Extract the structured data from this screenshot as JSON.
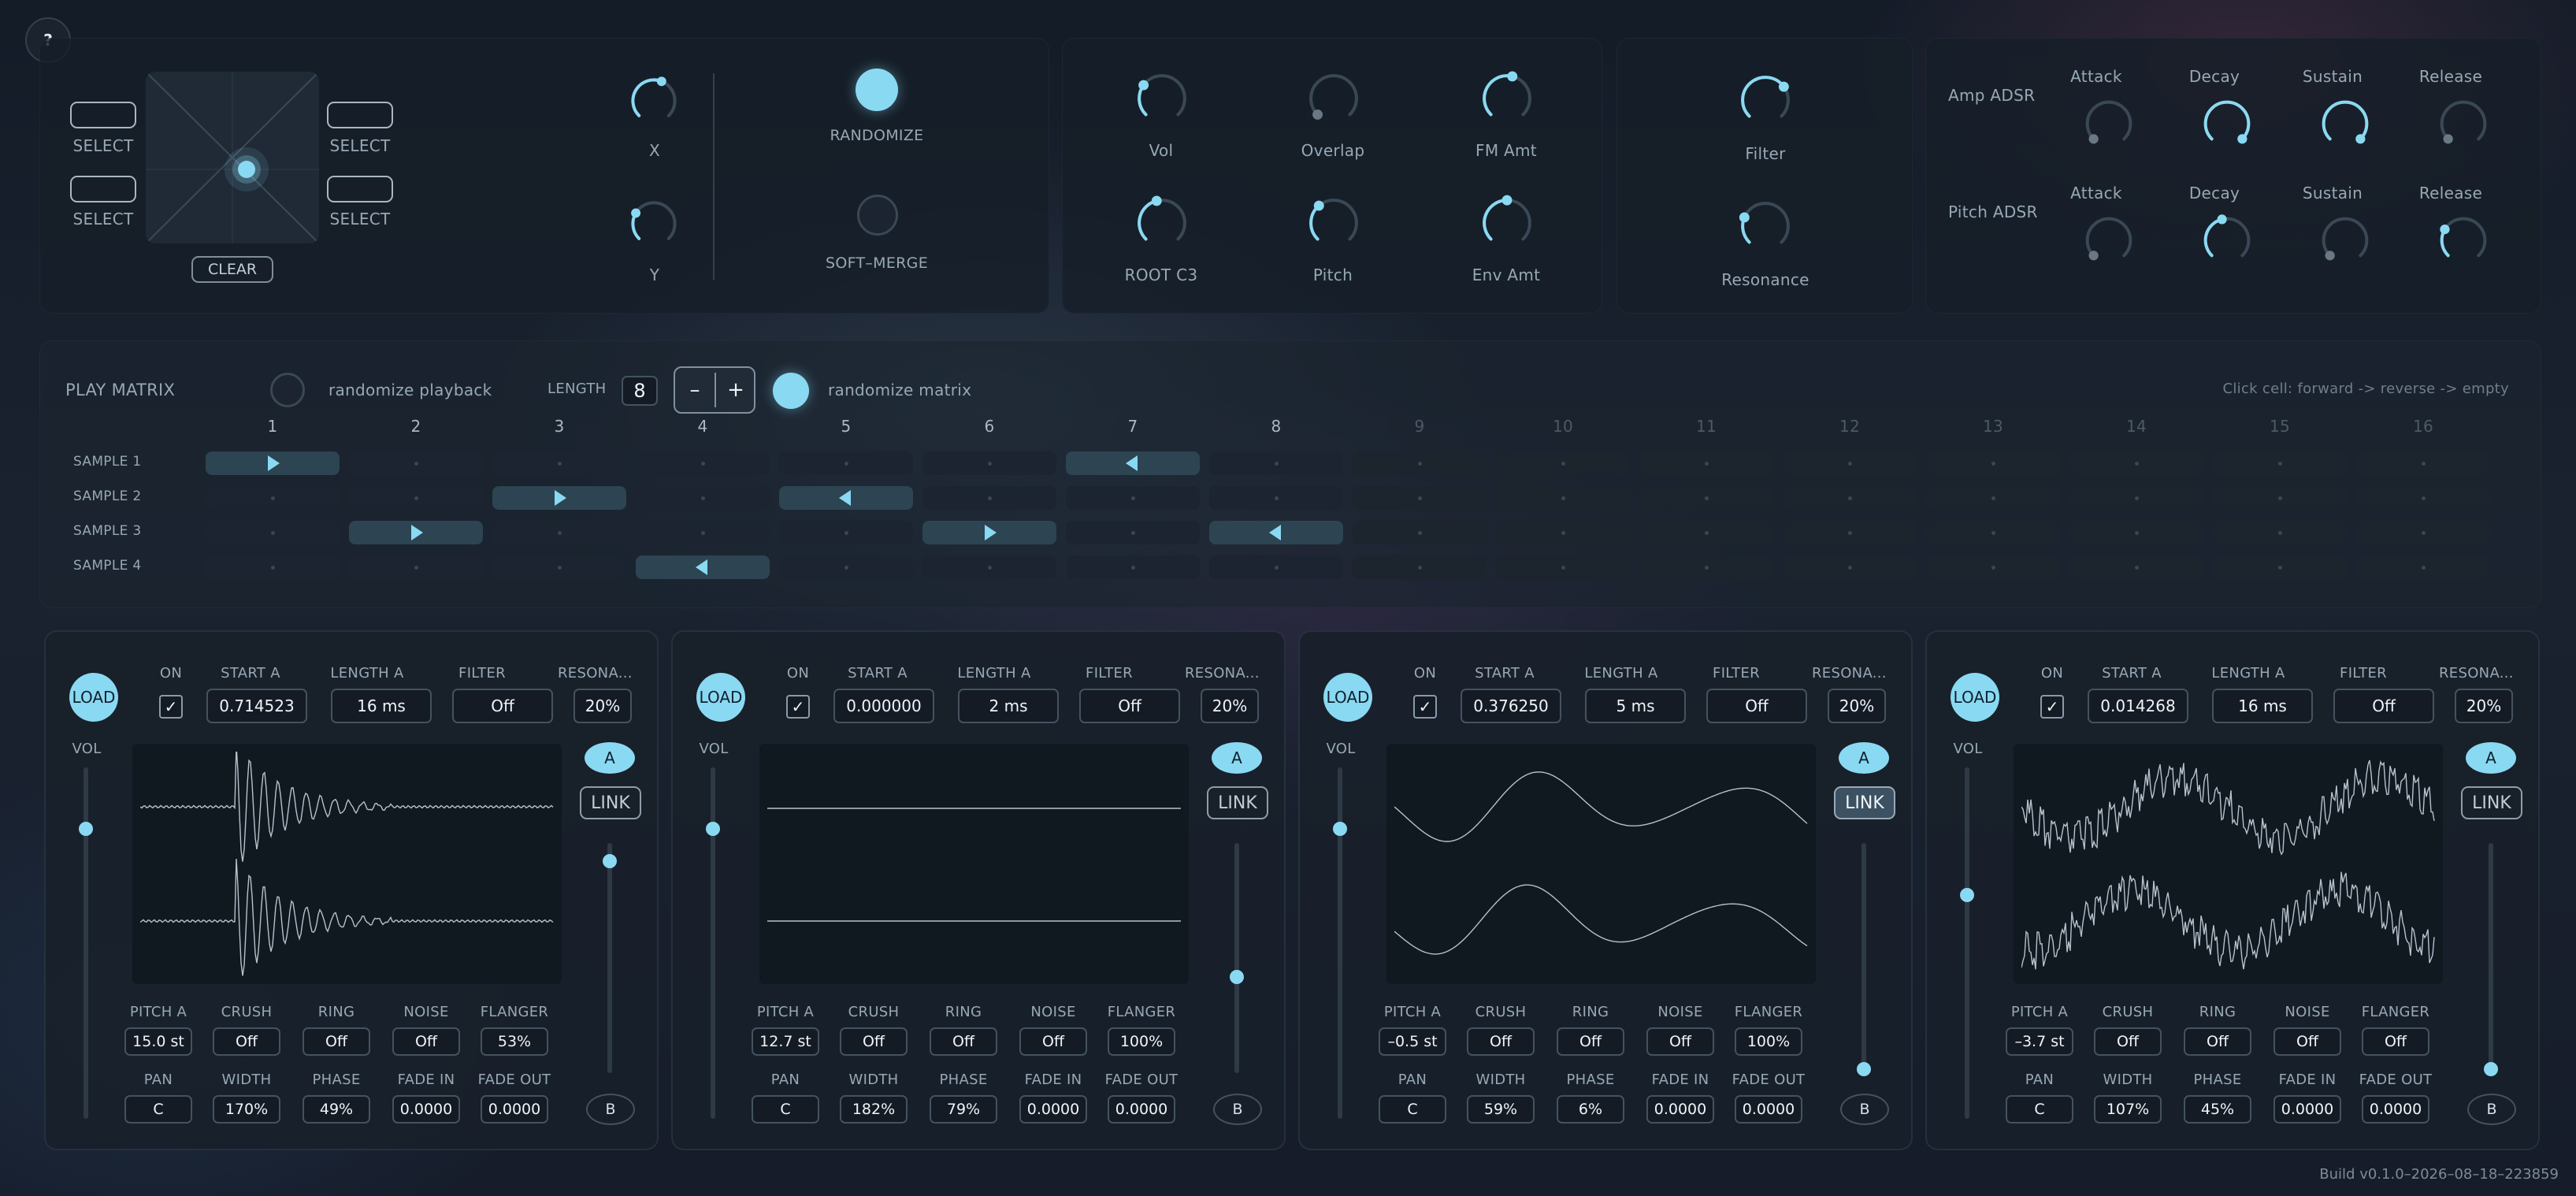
{
  "help_button": "?",
  "xy_pad": {
    "select_labels": [
      "SELECT",
      "SELECT",
      "SELECT",
      "SELECT"
    ],
    "clear_label": "CLEAR"
  },
  "xy_knobs": [
    {
      "label": "X",
      "value": 0.58
    },
    {
      "label": "Y",
      "value": 0.28
    }
  ],
  "morph": {
    "randomize_label": "RANDOMIZE",
    "soft_merge_label": "SOFT–MERGE"
  },
  "grain_knobs": [
    {
      "label": "Vol",
      "value": 0.3
    },
    {
      "label": "Overlap",
      "value": 0.0
    },
    {
      "label": "FM Amt",
      "value": 0.55
    },
    {
      "label": "ROOT C3",
      "value": 0.45
    },
    {
      "label": "Pitch",
      "value": 0.35
    },
    {
      "label": "Env Amt",
      "value": 0.5
    }
  ],
  "filter_knobs": [
    {
      "label": "Filter",
      "value": 0.7
    },
    {
      "label": "Resonance",
      "value": 0.25
    }
  ],
  "adsr": {
    "amp_title": "Amp ADSR",
    "pitch_title": "Pitch ADSR",
    "amp": [
      {
        "label": "Attack",
        "value": 0.0
      },
      {
        "label": "Decay",
        "value": 1.0
      },
      {
        "label": "Sustain",
        "value": 1.0
      },
      {
        "label": "Release",
        "value": 0.0
      }
    ],
    "pitch": [
      {
        "label": "Attack",
        "value": 0.0
      },
      {
        "label": "Decay",
        "value": 0.45
      },
      {
        "label": "Sustain",
        "value": 0.0
      },
      {
        "label": "Release",
        "value": 0.28
      }
    ]
  },
  "play_matrix": {
    "title": "PLAY MATRIX",
    "randomize_playback_label": "randomize playback",
    "length_label": "LENGTH",
    "length_value": "8",
    "minus_label": "–",
    "plus_label": "+",
    "randomize_matrix_label": "randomize matrix",
    "hint": "Click cell: forward -> reverse -> empty",
    "columns": [
      "1",
      "2",
      "3",
      "4",
      "5",
      "6",
      "7",
      "8",
      "9",
      "10",
      "11",
      "12",
      "13",
      "14",
      "15",
      "16"
    ],
    "rows": [
      {
        "label": "SAMPLE 1",
        "cells": [
          "fwd",
          "",
          "",
          "",
          "",
          "",
          "rev",
          "",
          "",
          "",
          "",
          "",
          "",
          "",
          "",
          ""
        ]
      },
      {
        "label": "SAMPLE 2",
        "cells": [
          "",
          "",
          "fwd",
          "",
          "rev",
          "",
          "",
          "",
          "",
          "",
          "",
          "",
          "",
          "",
          "",
          ""
        ]
      },
      {
        "label": "SAMPLE 3",
        "cells": [
          "",
          "fwd",
          "",
          "",
          "",
          "fwd",
          "",
          "rev",
          "",
          "",
          "",
          "",
          "",
          "",
          "",
          ""
        ]
      },
      {
        "label": "SAMPLE 4",
        "cells": [
          "",
          "",
          "",
          "rev",
          "",
          "",
          "",
          "",
          "",
          "",
          "",
          "",
          "",
          "",
          "",
          ""
        ]
      }
    ]
  },
  "sample_header_labels": {
    "load": "LOAD",
    "on": "ON",
    "start": "START A",
    "length": "LENGTH A",
    "filter": "FILTER",
    "resonance": "RESONA...",
    "vol": "VOL"
  },
  "sample_row_labels": {
    "row1": [
      "PITCH A",
      "CRUSH",
      "RING",
      "NOISE",
      "FLANGER"
    ],
    "row2": [
      "PAN",
      "WIDTH",
      "PHASE",
      "FADE IN",
      "FADE OUT"
    ]
  },
  "samples": [
    {
      "on": "✓",
      "start": "0.714523",
      "length": "16 ms",
      "filter": "Off",
      "resonance": "20%",
      "vol": 0.85,
      "a_label": "A",
      "link_label": "LINK",
      "link_active": false,
      "b_label": "B",
      "side": 0.05,
      "row1": [
        "15.0 st",
        "Off",
        "Off",
        "Off",
        "53%"
      ],
      "row2": [
        "C",
        "170%",
        "49%",
        "0.0000",
        "0.0000"
      ],
      "wave": "transient"
    },
    {
      "on": "✓",
      "start": "0.000000",
      "length": "2 ms",
      "filter": "Off",
      "resonance": "20%",
      "vol": 0.85,
      "a_label": "A",
      "link_label": "LINK",
      "link_active": false,
      "b_label": "B",
      "side": 0.58,
      "row1": [
        "12.7 st",
        "Off",
        "Off",
        "Off",
        "100%"
      ],
      "row2": [
        "C",
        "182%",
        "79%",
        "0.0000",
        "0.0000"
      ],
      "wave": "flat"
    },
    {
      "on": "✓",
      "start": "0.376250",
      "length": "5 ms",
      "filter": "Off",
      "resonance": "20%",
      "vol": 0.85,
      "a_label": "A",
      "link_label": "LINK",
      "link_active": true,
      "b_label": "B",
      "side": 1.0,
      "row1": [
        "–0.5 st",
        "Off",
        "Off",
        "Off",
        "100%"
      ],
      "row2": [
        "C",
        "59%",
        "6%",
        "0.0000",
        "0.0000"
      ],
      "wave": "sine"
    },
    {
      "on": "✓",
      "start": "0.014268",
      "length": "16 ms",
      "filter": "Off",
      "resonance": "20%",
      "vol": 0.65,
      "a_label": "A",
      "link_label": "LINK",
      "link_active": false,
      "b_label": "B",
      "side": 1.0,
      "row1": [
        "–3.7 st",
        "Off",
        "Off",
        "Off",
        "Off"
      ],
      "row2": [
        "C",
        "107%",
        "45%",
        "0.0000",
        "0.0000"
      ],
      "wave": "noisy"
    }
  ],
  "build_text": "Build v0.1.0–2026–08–18–223859",
  "colors": {
    "accent": "#8ad9f2",
    "panel": "#161e28",
    "text": "#97a8b5"
  }
}
